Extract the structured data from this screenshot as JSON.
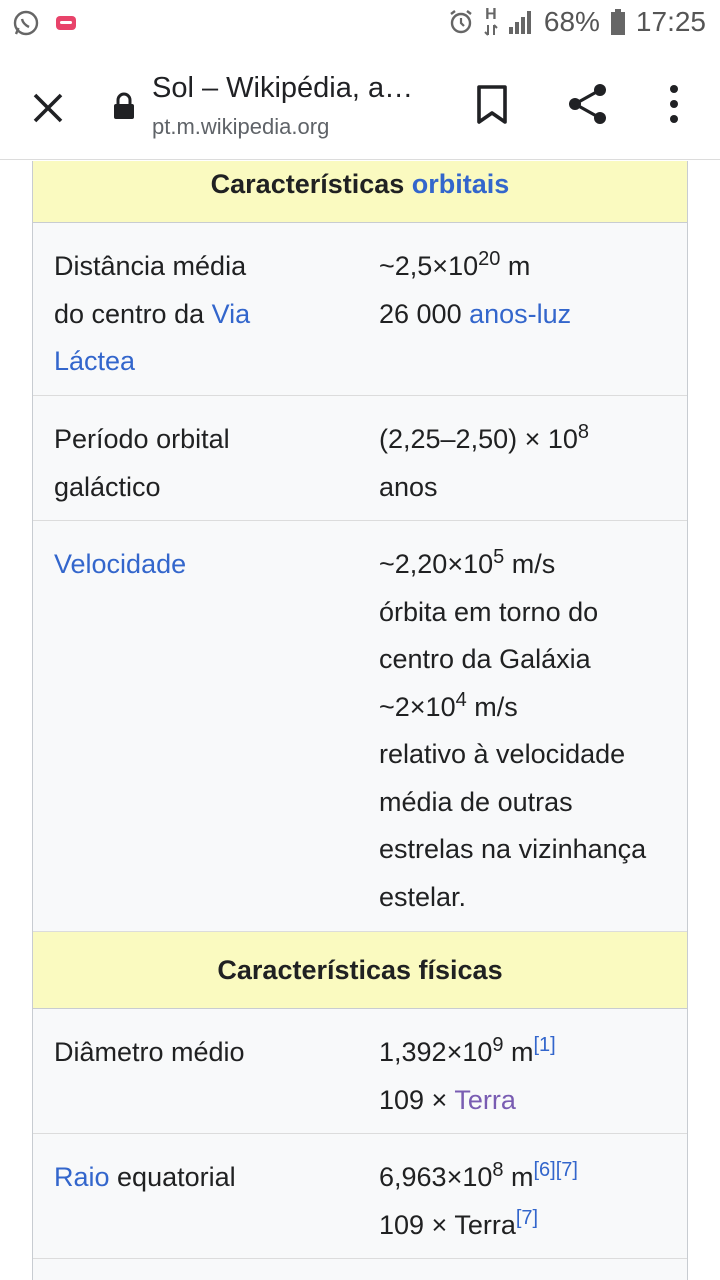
{
  "status_bar": {
    "battery": "68%",
    "time": "17:25",
    "network_letter": "H"
  },
  "browser": {
    "title": "Sol – Wikipédia, a…",
    "url": "pt.m.wikipedia.org"
  },
  "infobox": {
    "orbital": {
      "header_text": "Características ",
      "header_link": "orbitais",
      "rows": {
        "distance": {
          "label_line1": "Distância média",
          "label_line2_text": "do centro da ",
          "label_line2_link": "Via",
          "label_line3_link": "Láctea",
          "value_line1_prefix": "~2,5×10",
          "value_line1_exp": "20",
          "value_line1_suffix": " m",
          "value_line2_text": "26 000 ",
          "value_line2_link": "anos-luz"
        },
        "period": {
          "label_line1": "Período orbital",
          "label_line2": "galáctico",
          "value_line1_prefix": "(2,25–2,50) × 10",
          "value_line1_exp": "8",
          "value_line2": "anos"
        },
        "velocity": {
          "label_link": "Velocidade",
          "v1_prefix": "~2,20×10",
          "v1_exp": "5",
          "v1_suffix": " m/s",
          "v2": "órbita em torno do",
          "v3": "centro da Galáxia",
          "v4_prefix": "~2×10",
          "v4_exp": "4",
          "v4_suffix": " m/s",
          "v5": "relativo à velocidade",
          "v6": "média de outras",
          "v7": "estrelas na vizinhança",
          "v8": "estelar."
        }
      }
    },
    "physical": {
      "header": "Características físicas",
      "rows": {
        "diameter": {
          "label": "Diâmetro médio",
          "v1_prefix": "1,392×10",
          "v1_exp": "9",
          "v1_suffix": " m",
          "v1_ref": "[1]",
          "v2_prefix": "109 × ",
          "v2_link": "Terra"
        },
        "radius": {
          "label_link": "Raio",
          "label_text": " equatorial",
          "v1_prefix": "6,963×10",
          "v1_exp": "8",
          "v1_suffix": " m",
          "v1_ref1": "[6]",
          "v1_ref2": "[7]",
          "v2_prefix": "109 × Terra",
          "v2_ref": "[7]"
        }
      }
    }
  }
}
